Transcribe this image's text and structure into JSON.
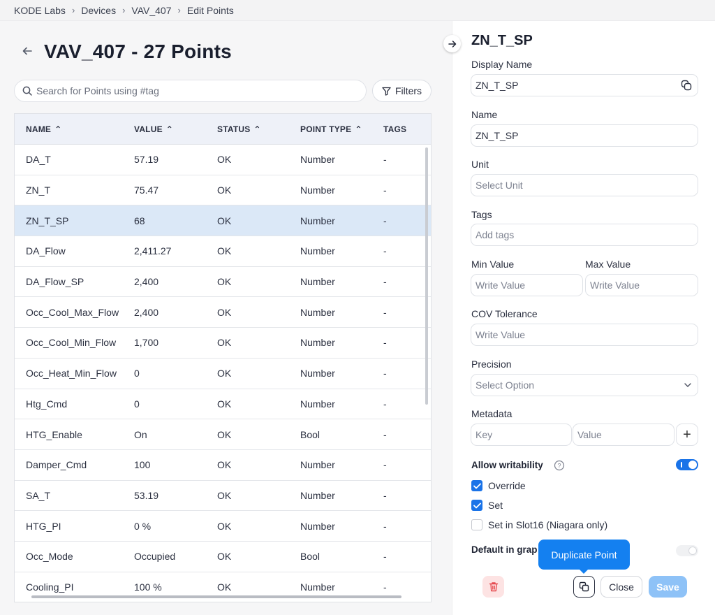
{
  "breadcrumb": [
    "KODE Labs",
    "Devices",
    "VAV_407",
    "Edit Points"
  ],
  "page": {
    "title": "VAV_407 - 27 Points"
  },
  "search": {
    "placeholder": "Search for Points using #tag"
  },
  "filters_label": "Filters",
  "table": {
    "columns": [
      "NAME",
      "VALUE",
      "STATUS",
      "POINT TYPE",
      "TAGS"
    ],
    "rows": [
      {
        "name": "DA_T",
        "value": "57.19",
        "status": "OK",
        "type": "Number",
        "tags": "-"
      },
      {
        "name": "ZN_T",
        "value": "75.47",
        "status": "OK",
        "type": "Number",
        "tags": "-"
      },
      {
        "name": "ZN_T_SP",
        "value": "68",
        "status": "OK",
        "type": "Number",
        "tags": "-"
      },
      {
        "name": "DA_Flow",
        "value": "2,411.27",
        "status": "OK",
        "type": "Number",
        "tags": "-"
      },
      {
        "name": "DA_Flow_SP",
        "value": "2,400",
        "status": "OK",
        "type": "Number",
        "tags": "-"
      },
      {
        "name": "Occ_Cool_Max_Flow",
        "value": "2,400",
        "status": "OK",
        "type": "Number",
        "tags": "-"
      },
      {
        "name": "Occ_Cool_Min_Flow",
        "value": "1,700",
        "status": "OK",
        "type": "Number",
        "tags": "-"
      },
      {
        "name": "Occ_Heat_Min_Flow",
        "value": "0",
        "status": "OK",
        "type": "Number",
        "tags": "-"
      },
      {
        "name": "Htg_Cmd",
        "value": "0",
        "status": "OK",
        "type": "Number",
        "tags": "-"
      },
      {
        "name": "HTG_Enable",
        "value": "On",
        "status": "OK",
        "type": "Bool",
        "tags": "-"
      },
      {
        "name": "Damper_Cmd",
        "value": "100",
        "status": "OK",
        "type": "Number",
        "tags": "-"
      },
      {
        "name": "SA_T",
        "value": "53.19",
        "status": "OK",
        "type": "Number",
        "tags": "-"
      },
      {
        "name": "HTG_PI",
        "value": "0 %",
        "status": "OK",
        "type": "Number",
        "tags": "-"
      },
      {
        "name": "Occ_Mode",
        "value": "Occupied",
        "status": "OK",
        "type": "Bool",
        "tags": "-"
      },
      {
        "name": "Cooling_PI",
        "value": "100 %",
        "status": "OK",
        "type": "Number",
        "tags": "-"
      }
    ]
  },
  "panel": {
    "title": "ZN_T_SP",
    "display_name_label": "Display Name",
    "display_name_value": "ZN_T_SP",
    "name_label": "Name",
    "name_value": "ZN_T_SP",
    "unit_label": "Unit",
    "unit_placeholder": "Select Unit",
    "tags_label": "Tags",
    "tags_placeholder": "Add tags",
    "min_label": "Min Value",
    "max_label": "Max Value",
    "min_placeholder": "Write Value",
    "max_placeholder": "Write Value",
    "cov_label": "COV Tolerance",
    "cov_placeholder": "Write Value",
    "precision_label": "Precision",
    "precision_placeholder": "Select Option",
    "metadata_label": "Metadata",
    "key_placeholder": "Key",
    "value_placeholder": "Value",
    "plus": "+",
    "writability_label": "Allow writability",
    "writability_on": true,
    "checkboxes": [
      {
        "label": "Override",
        "checked": true
      },
      {
        "label": "Set",
        "checked": true
      },
      {
        "label": "Set in Slot16 (Niagara only)",
        "checked": false
      }
    ],
    "default_graph_label": "Default in grap",
    "tooltip": "Duplicate Point",
    "close_label": "Close",
    "save_label": "Save"
  },
  "colors": {
    "accent": "#1a73e8",
    "selected_row": "#dbe8f7",
    "save_disabled": "#8ec2f7",
    "danger_bg": "#fde3e3",
    "danger": "#e5484d"
  }
}
